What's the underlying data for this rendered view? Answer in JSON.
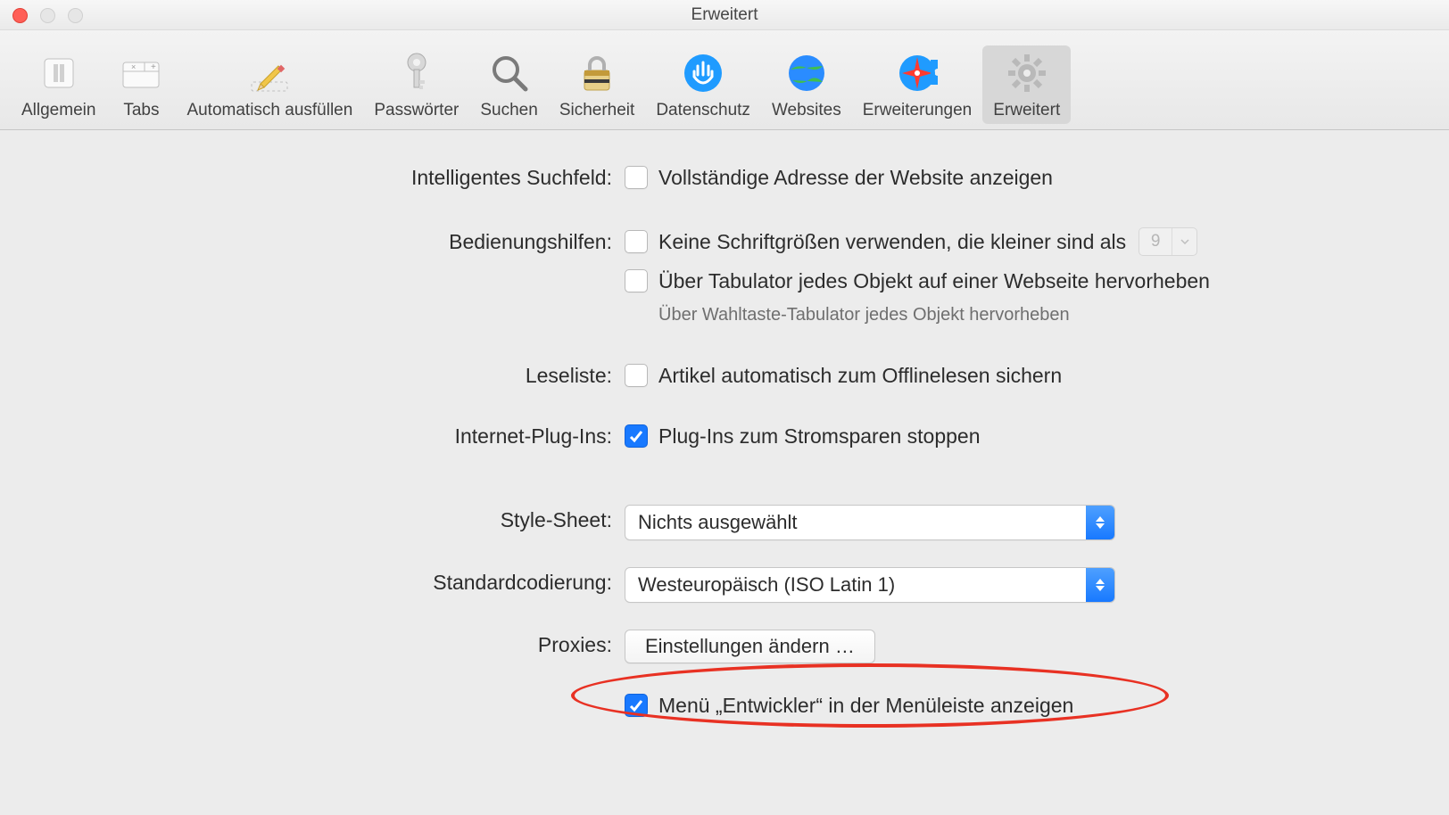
{
  "window": {
    "title": "Erweitert"
  },
  "toolbar": [
    {
      "id": "general",
      "label": "Allgemein",
      "icon": "switch-icon"
    },
    {
      "id": "tabs",
      "label": "Tabs",
      "icon": "tabs-icon"
    },
    {
      "id": "autofill",
      "label": "Automatisch ausfüllen",
      "icon": "pencil-icon"
    },
    {
      "id": "passwords",
      "label": "Passwörter",
      "icon": "key-icon"
    },
    {
      "id": "search",
      "label": "Suchen",
      "icon": "magnifier-icon"
    },
    {
      "id": "security",
      "label": "Sicherheit",
      "icon": "padlock-icon"
    },
    {
      "id": "privacy",
      "label": "Datenschutz",
      "icon": "privacy-hand-icon"
    },
    {
      "id": "websites",
      "label": "Websites",
      "icon": "globe-icon"
    },
    {
      "id": "extensions",
      "label": "Erweiterungen",
      "icon": "puzzle-icon"
    },
    {
      "id": "advanced",
      "label": "Erweitert",
      "icon": "gear-icon",
      "selected": true
    }
  ],
  "rows": {
    "smartSearch": {
      "label": "Intelligentes Suchfeld:",
      "showFullAddress": {
        "checked": false,
        "text": "Vollständige Adresse der Website anzeigen"
      }
    },
    "accessibility": {
      "label": "Bedienungshilfen:",
      "minFont": {
        "checked": false,
        "text": "Keine Schriftgrößen verwenden, die kleiner sind als",
        "value": "9"
      },
      "tabHighlight": {
        "checked": false,
        "text": "Über Tabulator jedes Objekt auf einer Webseite hervorheben"
      },
      "hint": "Über Wahltaste-Tabulator jedes Objekt hervorheben"
    },
    "readingList": {
      "label": "Leseliste:",
      "offline": {
        "checked": false,
        "text": "Artikel automatisch zum Offlinelesen sichern"
      }
    },
    "plugins": {
      "label": "Internet-Plug-Ins:",
      "powerSave": {
        "checked": true,
        "text": "Plug-Ins zum Stromsparen stoppen"
      }
    },
    "styleSheet": {
      "label": "Style-Sheet:",
      "value": "Nichts ausgewählt"
    },
    "encoding": {
      "label": "Standardcodierung:",
      "value": "Westeuropäisch (ISO Latin 1)"
    },
    "proxies": {
      "label": "Proxies:",
      "button": "Einstellungen ändern …"
    },
    "devMenu": {
      "label": "",
      "show": {
        "checked": true,
        "text": "Menü „Entwickler“ in der Menüleiste anzeigen"
      }
    }
  },
  "annotation": {
    "circled": "devMenu"
  }
}
